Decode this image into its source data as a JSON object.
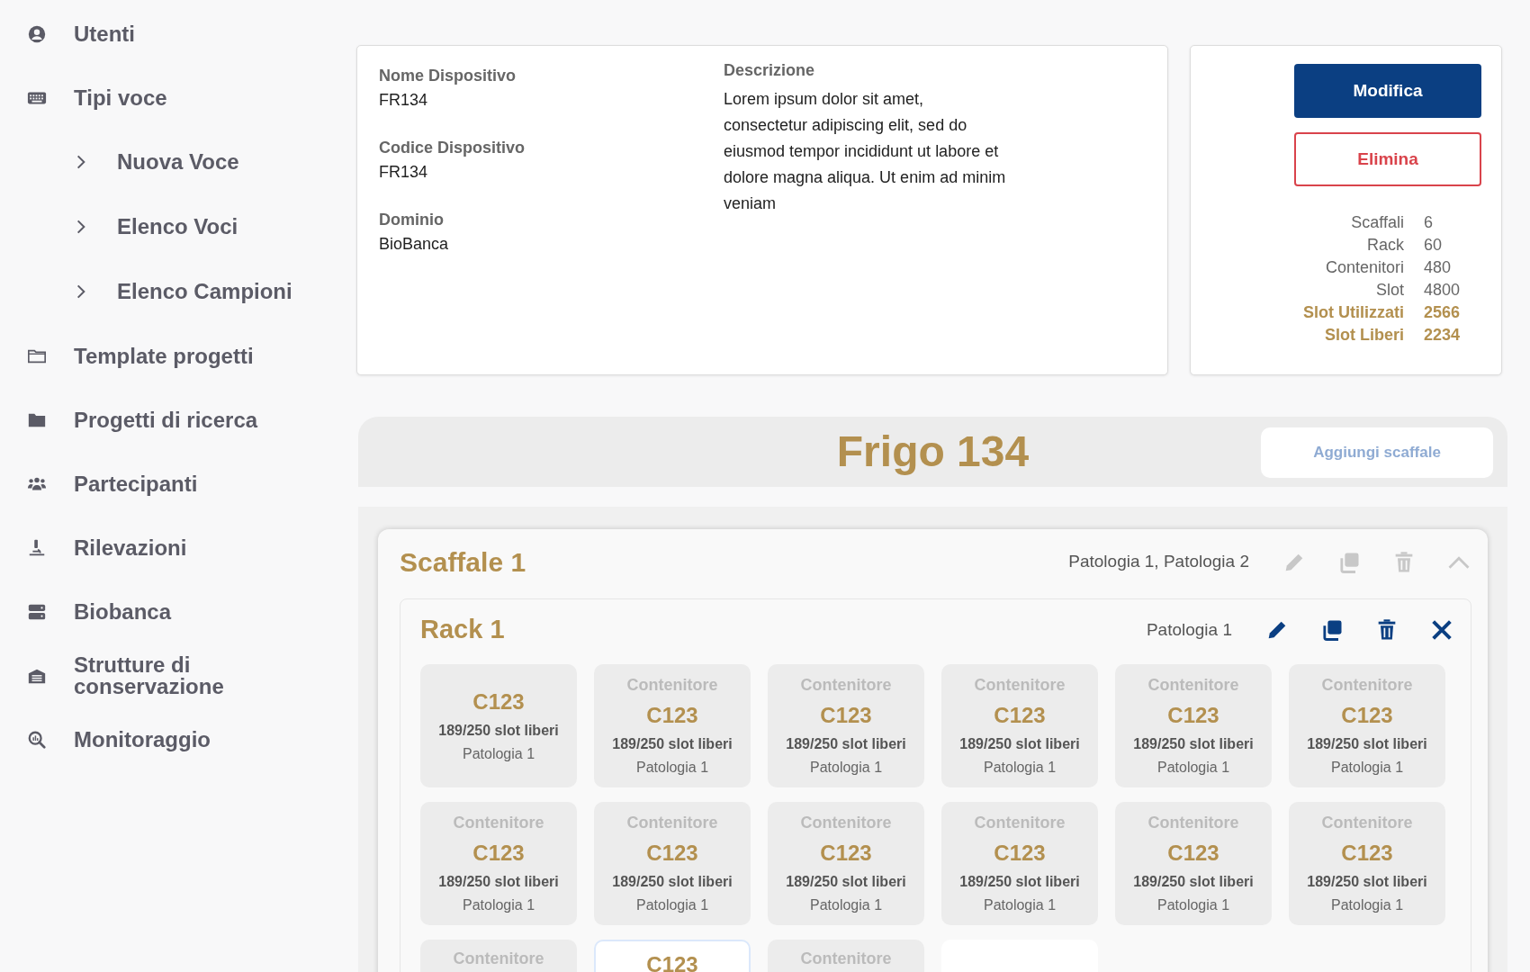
{
  "sidebar": {
    "items": [
      {
        "label": "Utenti",
        "kind": "user"
      },
      {
        "label": "Tipi voce",
        "kind": "keyboard",
        "children": [
          {
            "label": "Nuova Voce"
          },
          {
            "label": "Elenco Voci"
          },
          {
            "label": "Elenco Campioni"
          }
        ]
      },
      {
        "label": "Template progetti",
        "kind": "folder-outline"
      },
      {
        "label": "Progetti di ricerca",
        "kind": "folder"
      },
      {
        "label": "Partecipanti",
        "kind": "people"
      },
      {
        "label": "Rilevazioni",
        "kind": "microscope"
      },
      {
        "label": "Biobanca",
        "kind": "server"
      },
      {
        "label": "Strutture di conservazione",
        "kind": "warehouse"
      },
      {
        "label": "Monitoraggio",
        "kind": "search-chart"
      }
    ]
  },
  "device": {
    "fields": [
      {
        "label": "Nome Dispositivo",
        "value": "FR134"
      },
      {
        "label": "Codice Dispositivo",
        "value": "FR134"
      },
      {
        "label": "Dominio",
        "value": "BioBanca"
      }
    ],
    "description": {
      "label": "Descrizione",
      "value": "Lorem ipsum dolor sit amet, consectetur adipiscing elit, sed do eiusmod tempor incididunt ut labore et dolore magna aliqua. Ut enim ad minim veniam"
    }
  },
  "actions": {
    "buttons": [
      {
        "label": "Modifica",
        "kind": "primary"
      },
      {
        "label": "Elimina",
        "kind": "danger"
      }
    ],
    "stats": [
      {
        "label": "Scaffali",
        "value": "6",
        "highlight": false
      },
      {
        "label": "Rack",
        "value": "60",
        "highlight": false
      },
      {
        "label": "Contenitori",
        "value": "480",
        "highlight": false
      },
      {
        "label": "Slot",
        "value": "4800",
        "highlight": false
      },
      {
        "label": "Slot Utilizzati",
        "value": "2566",
        "highlight": true
      },
      {
        "label": "Slot Liberi",
        "value": "2234",
        "highlight": true
      }
    ]
  },
  "fridge": {
    "title": "Frigo 134",
    "add_button": "Aggiungi scaffale"
  },
  "shelf": {
    "title": "Scaffale 1",
    "pathologies": "Patologia 1, Patologia 2",
    "actions": [
      {
        "kind": "pencil",
        "disabled": true
      },
      {
        "kind": "copy",
        "disabled": true
      },
      {
        "kind": "trash",
        "disabled": true
      },
      {
        "kind": "chevron-up",
        "disabled": true
      }
    ],
    "rack": {
      "title": "Rack 1",
      "pathologies": "Patologia 1",
      "actions": [
        {
          "kind": "pencil",
          "disabled": false
        },
        {
          "kind": "copy",
          "disabled": false
        },
        {
          "kind": "trash",
          "disabled": false
        },
        {
          "kind": "close",
          "disabled": false
        }
      ],
      "containers": [
        {
          "kind": "compact",
          "code": "C123",
          "slots": "189/250 slot liberi",
          "pathology": "Patologia 1",
          "selected": false
        },
        {
          "kind": "full",
          "label": "Contenitore",
          "code": "C123",
          "slots": "189/250 slot liberi",
          "pathology": "Patologia 1",
          "selected": false
        },
        {
          "kind": "full",
          "label": "Contenitore",
          "code": "C123",
          "slots": "189/250 slot liberi",
          "pathology": "Patologia 1",
          "selected": false
        },
        {
          "kind": "full",
          "label": "Contenitore",
          "code": "C123",
          "slots": "189/250 slot liberi",
          "pathology": "Patologia 1",
          "selected": false
        },
        {
          "kind": "full",
          "label": "Contenitore",
          "code": "C123",
          "slots": "189/250 slot liberi",
          "pathology": "Patologia 1",
          "selected": false
        },
        {
          "kind": "full",
          "label": "Contenitore",
          "code": "C123",
          "slots": "189/250 slot liberi",
          "pathology": "Patologia 1",
          "selected": false
        },
        {
          "kind": "full",
          "label": "Contenitore",
          "code": "C123",
          "slots": "189/250 slot liberi",
          "pathology": "Patologia 1",
          "selected": false
        },
        {
          "kind": "full",
          "label": "Contenitore",
          "code": "C123",
          "slots": "189/250 slot liberi",
          "pathology": "Patologia 1",
          "selected": false
        },
        {
          "kind": "full",
          "label": "Contenitore",
          "code": "C123",
          "slots": "189/250 slot liberi",
          "pathology": "Patologia 1",
          "selected": false
        },
        {
          "kind": "full",
          "label": "Contenitore",
          "code": "C123",
          "slots": "189/250 slot liberi",
          "pathology": "Patologia 1",
          "selected": false
        },
        {
          "kind": "full",
          "label": "Contenitore",
          "code": "C123",
          "slots": "189/250 slot liberi",
          "pathology": "Patologia 1",
          "selected": false
        },
        {
          "kind": "full",
          "label": "Contenitore",
          "code": "C123",
          "slots": "189/250 slot liberi",
          "pathology": "Patologia 1",
          "selected": false
        },
        {
          "kind": "cut",
          "label": "Contenitore",
          "selected": false
        },
        {
          "kind": "cut",
          "label": "C123",
          "selected": true
        },
        {
          "kind": "cut",
          "label": "Contenitore",
          "selected": false
        },
        {
          "kind": "empty",
          "selected": false
        }
      ]
    }
  }
}
